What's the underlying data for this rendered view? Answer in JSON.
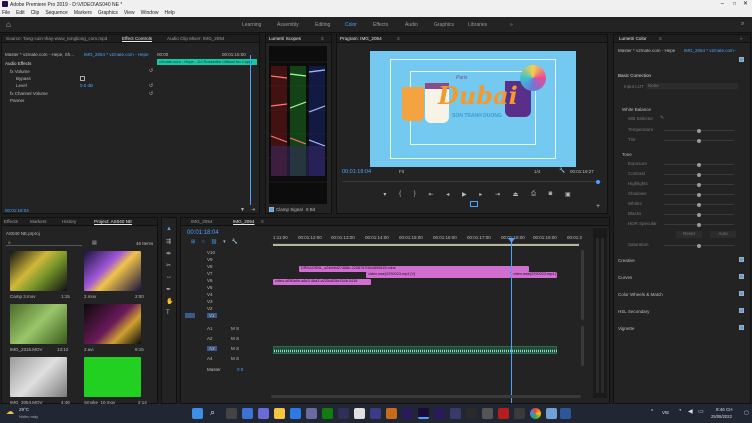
{
  "window": {
    "title": "Adobe Premiere Pro 2019 - D:\\VIDEO\\AS040 NE *"
  },
  "menu": [
    "File",
    "Edit",
    "Clip",
    "Sequence",
    "Markers",
    "Graphics",
    "View",
    "Window",
    "Help"
  ],
  "workspaces": [
    "Learning",
    "Assembly",
    "Editing",
    "Color",
    "Effects",
    "Audio",
    "Graphics",
    "Libraries"
  ],
  "workspace_active": "Color",
  "source_tabs": [
    "Source: Tang-cuin-thay-www_tongliong_com.mp3",
    "Effect Controls",
    "Audio Clip Mixer: IMG_2054"
  ],
  "effect_controls": {
    "master": "Master * v2mate.com - Hepe, Sh...",
    "clip": "IMG_2054 * v2mate.com - Hepe",
    "timecode_a": "00:00",
    "timecode_b": "00:01:15:00",
    "clip_bar": "v2mate.com - Hepe - DJ Rossinfire Official No Copyr",
    "section": "Audio Effects",
    "items": [
      {
        "label": "fx Volume"
      },
      {
        "label": "Bypass"
      },
      {
        "label": "Level",
        "value": "0.0 dB"
      },
      {
        "label": "fx Channel Volume"
      },
      {
        "label": "Panner"
      }
    ],
    "time": "00:01:18:04"
  },
  "lumetri_scopes": {
    "tab": "Lumetri Scopes",
    "clamp": "Clamp Signal",
    "bits": "8 Bit"
  },
  "program": {
    "tab": "Program: IMG_2054",
    "timecode": "00:01:18:04",
    "fit": "Fit",
    "ratio": "1/4",
    "duration": "00:01:19:27",
    "logo_main": "Dubai",
    "logo_top": "Paris",
    "logo_sub": "SON TRANH DUONG"
  },
  "lumetri_color": {
    "tab": "Lumetri Color",
    "master": "Master * v2mate.com - Hepe",
    "clip": "IMG_2054 * v2mate.com - Hepe",
    "basic": "Basic Correction",
    "input_lut": "Input LUT",
    "input_lut_value": "None",
    "white_balance": "White Balance",
    "wb_selector": "WB Selector",
    "temperature": "Temperature",
    "tint": "Tint",
    "tone": "Tone",
    "tone_items": [
      "Exposure",
      "Contrast",
      "Highlights",
      "Shadows",
      "Whites",
      "Blacks",
      "HDR Specular"
    ],
    "reset": "Reset",
    "auto": "Auto",
    "saturation": "Saturation",
    "sections": [
      "Creative",
      "Curves",
      "Color Wheels & Match",
      "HSL Secondary",
      "Vignette"
    ]
  },
  "project": {
    "tabs": [
      "Effects",
      "Markers",
      "History",
      "Project: AS040 NE"
    ],
    "name": "AS040 NE.prproj",
    "count": "46 Items",
    "items": [
      {
        "name": "Camp 3.mov",
        "dur": "1:15",
        "color": "#e0c23a"
      },
      {
        "name": "2.mov",
        "dur": "2:00",
        "color": "#a259d9"
      },
      {
        "name": "IMG_2315.MOV",
        "dur": "13:12",
        "color": "#7cb342"
      },
      {
        "name": "2.avi",
        "dur": "9:15",
        "color": "#8a1f6c"
      },
      {
        "name": "IMG_2054.MOV",
        "dur": "4:46",
        "color": "#b0b0b0"
      },
      {
        "name": "Smoke_10.mov",
        "dur": "2:14",
        "color": "#22d022"
      }
    ]
  },
  "timeline": {
    "tabs": [
      "IMG_2054",
      "IMG_2054"
    ],
    "timecode": "00:01:18:04",
    "ruler": [
      "1:11:00",
      "00:01:12:00",
      "00:01:13:00",
      "00:01:14:00",
      "00:01:15:00",
      "00:01:16:00",
      "00:01:17:00",
      "00:01:18:00",
      "00:01:19:00",
      "00:01:2"
    ],
    "video_tracks": [
      "V10",
      "V9",
      "V8",
      "V7",
      "V6",
      "V5",
      "V4",
      "V3",
      "V2",
      "V1"
    ],
    "audio_tracks": [
      "A1",
      "A2",
      "A3",
      "A4"
    ],
    "master": "Master",
    "master_val": "0.0",
    "clips": [
      {
        "label": "DRDAOSNL_s24ebfd27488b-2208767f4b4890615.mine",
        "color": "#d06fd0"
      },
      {
        "label": "video.wse(2290023.mp4 [V]",
        "color": "#d06fd0"
      },
      {
        "label": "video-df3f0a9e-a8c3-4ba3-a225c625e154b.0416",
        "color": "#d06fd0"
      },
      {
        "label": "video.wse(2290023.mp4 [V]",
        "color": "#d06fd0"
      }
    ]
  },
  "taskbar": {
    "weather_temp": "29°C",
    "weather_desc": "Nhiều mây",
    "lang": "VIE",
    "time": "8:46 CH",
    "date": "25/08/2022"
  },
  "colors": {
    "accent": "#4aa3ff",
    "timeline_playhead": "#4aa3ff",
    "clip_pink": "#d06fd0"
  }
}
